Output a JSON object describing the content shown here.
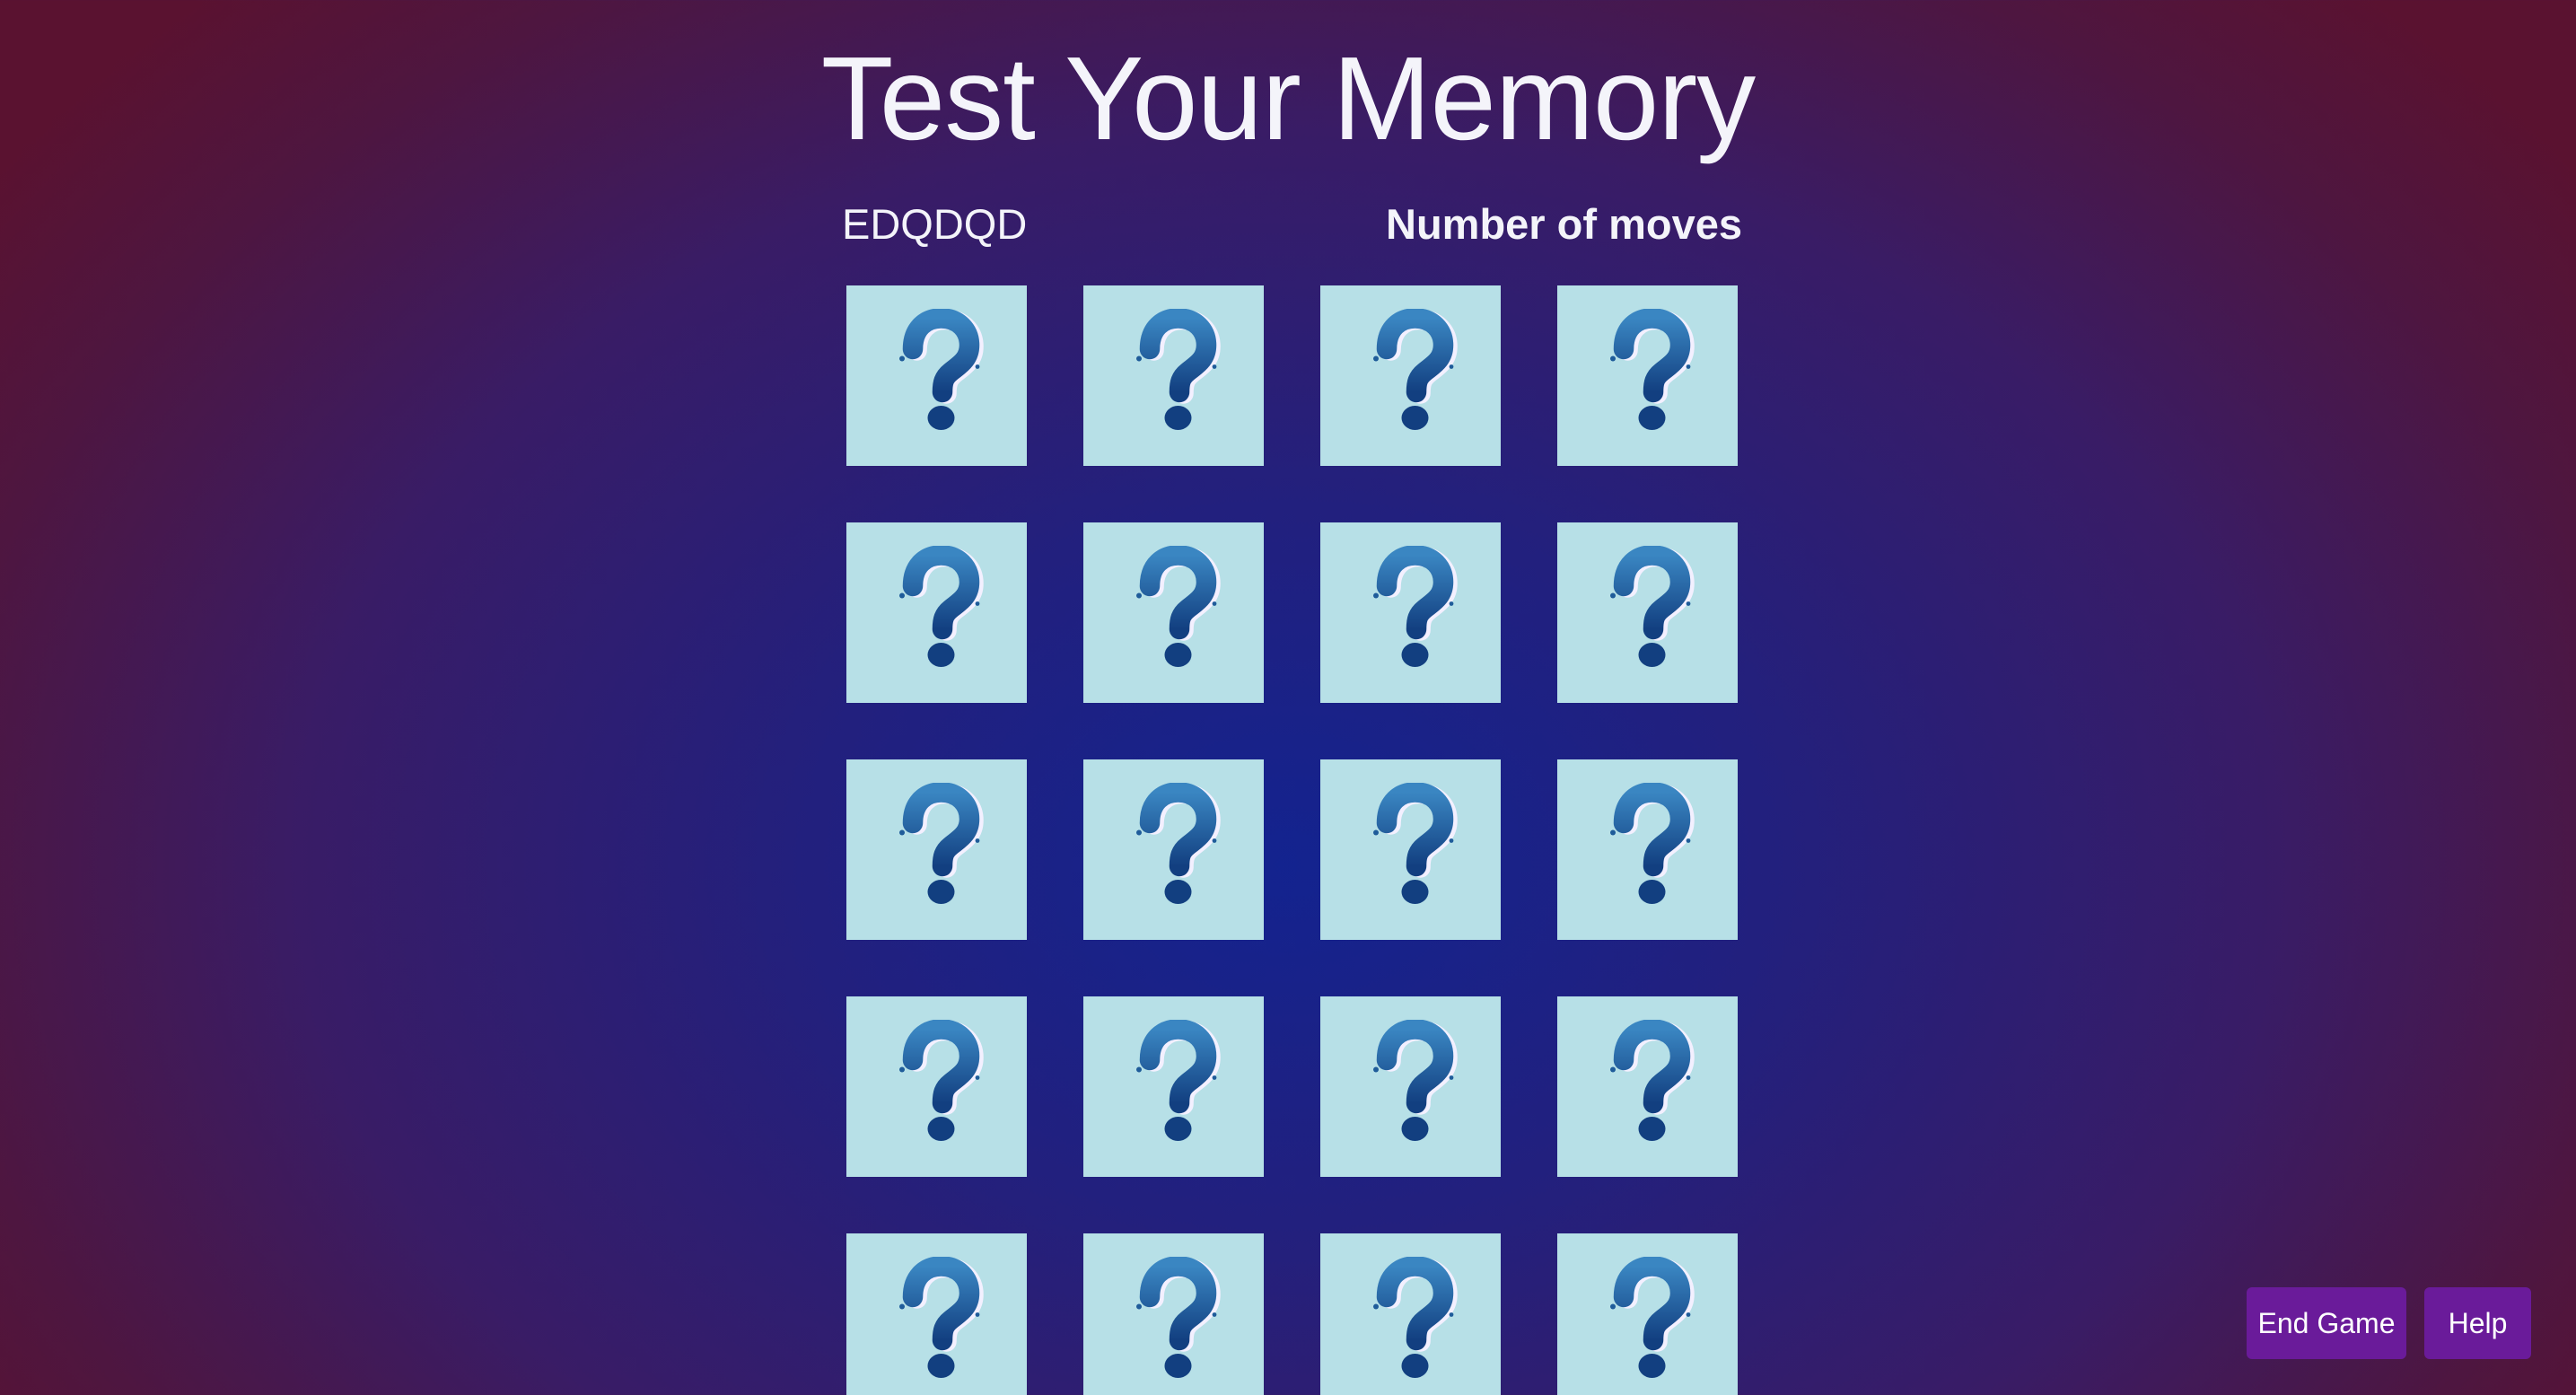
{
  "header": {
    "title": "Test Your Memory"
  },
  "status": {
    "player_name": "EDQDQD",
    "moves_label": "Number of moves"
  },
  "board": {
    "rows": 5,
    "columns": 4,
    "cards": [
      {
        "icon": "question-mark-icon",
        "state": "face-down"
      },
      {
        "icon": "question-mark-icon",
        "state": "face-down"
      },
      {
        "icon": "question-mark-icon",
        "state": "face-down"
      },
      {
        "icon": "question-mark-icon",
        "state": "face-down"
      },
      {
        "icon": "question-mark-icon",
        "state": "face-down"
      },
      {
        "icon": "question-mark-icon",
        "state": "face-down"
      },
      {
        "icon": "question-mark-icon",
        "state": "face-down"
      },
      {
        "icon": "question-mark-icon",
        "state": "face-down"
      },
      {
        "icon": "question-mark-icon",
        "state": "face-down"
      },
      {
        "icon": "question-mark-icon",
        "state": "face-down"
      },
      {
        "icon": "question-mark-icon",
        "state": "face-down"
      },
      {
        "icon": "question-mark-icon",
        "state": "face-down"
      },
      {
        "icon": "question-mark-icon",
        "state": "face-down"
      },
      {
        "icon": "question-mark-icon",
        "state": "face-down"
      },
      {
        "icon": "question-mark-icon",
        "state": "face-down"
      },
      {
        "icon": "question-mark-icon",
        "state": "face-down"
      },
      {
        "icon": "question-mark-icon",
        "state": "face-down"
      },
      {
        "icon": "question-mark-icon",
        "state": "face-down"
      },
      {
        "icon": "question-mark-icon",
        "state": "face-down"
      },
      {
        "icon": "question-mark-icon",
        "state": "face-down"
      }
    ]
  },
  "controls": {
    "end_game_label": "End Game",
    "help_label": "Help"
  },
  "colors": {
    "background_center": "#13238f",
    "background_edge": "#5a1230",
    "card_background": "#b7e0e7",
    "question_mark": "#1f5c9a",
    "button_background": "#6a1b9a",
    "text": "#f4f4fa"
  }
}
